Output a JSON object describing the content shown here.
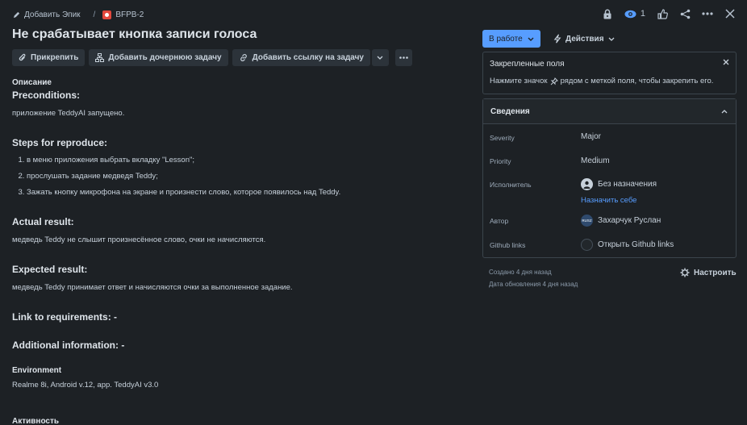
{
  "header": {
    "add_epic": "Добавить Эпик",
    "separator": "/",
    "issue_key": "BFPB-2",
    "watchers_count": "1"
  },
  "issue": {
    "title": "Не срабатывает кнопка записи голоса"
  },
  "toolbar": {
    "attach": "Прикрепить",
    "add_child": "Добавить дочернюю задачу",
    "add_link": "Добавить ссылку на задачу"
  },
  "description": {
    "label": "Описание",
    "preconditions_heading": "Preconditions:",
    "preconditions_text": "приложение TeddyAI запущено.",
    "steps_heading": "Steps for reproduce:",
    "steps": [
      "в меню приложения выбрать вкладку \"Lesson\";",
      "прослушать  задание медведя Teddy;",
      "Зажать кнопку микрофона на экране и произнести слово, которое появилось над Teddy."
    ],
    "actual_heading": "Actual result:",
    "actual_text": "медведь Teddy не слышит произнесённое слово, очки не начисляются.",
    "expected_heading": "Expected result:",
    "expected_text": "медведь Teddy принимает ответ и начисляются очки за выполненное задание.",
    "link_req": "Link to requirements: -",
    "additional": "Additional information: -"
  },
  "environment": {
    "label": "Environment",
    "value": "Realme 8i, Android v.12, app. TeddyAI v3.0"
  },
  "activity": {
    "label": "Активность"
  },
  "status": {
    "label": "В работе",
    "color": "#579dff"
  },
  "actions": {
    "label": "Действия"
  },
  "pinned_fields": {
    "title": "Закрепленные поля",
    "hint_before": "Нажмите значок",
    "hint_after": "рядом с меткой поля, чтобы закрепить его."
  },
  "details": {
    "title": "Сведения",
    "severity_label": "Severity",
    "severity_value": "Major",
    "priority_label": "Priority",
    "priority_value": "Medium",
    "assignee_label": "Исполнитель",
    "assignee_value": "Без назначения",
    "assign_to_me": "Назначить себе",
    "reporter_label": "Автор",
    "reporter_value": "Захарчук Руслан",
    "reporter_initials": "RUSZ",
    "github_label": "Github links",
    "github_value": "Открыть Github links"
  },
  "meta": {
    "created": "Создано 4 дня назад",
    "updated": "Дата обновления 4 дня назад",
    "configure": "Настроить"
  }
}
